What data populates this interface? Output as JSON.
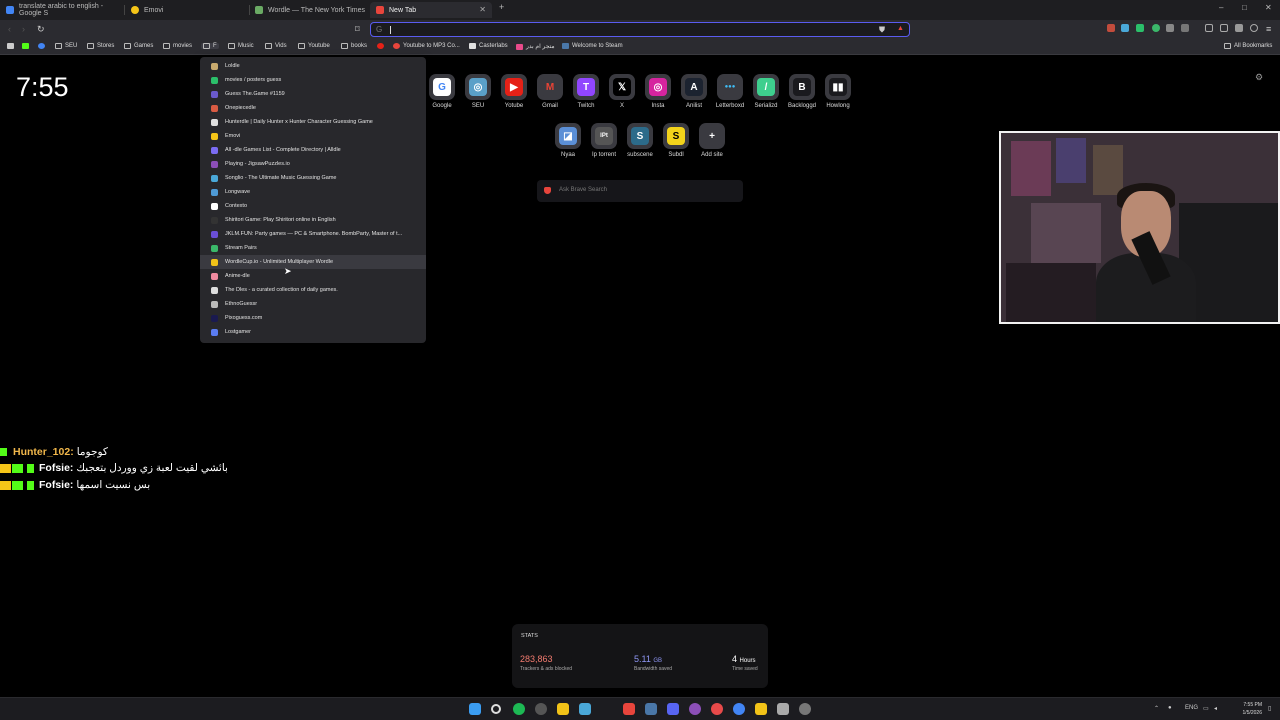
{
  "tabs": [
    {
      "title": "translate arabic to english - Google S",
      "icon_color": "#4285f4",
      "active": false
    },
    {
      "title": "Emovi",
      "icon_color": "#f5c518",
      "active": false
    },
    {
      "title": "Wordle — The New York Times",
      "icon_color": "#6aaa64",
      "active": false
    },
    {
      "title": "New Tab",
      "icon_color": "#e8453c",
      "active": true
    }
  ],
  "new_tab_symbol": "+",
  "window_controls": {
    "minimize": "–",
    "maximize": "□",
    "close": "✕"
  },
  "address_bar": {
    "value": "",
    "search_engine_glyph": "G"
  },
  "bookmarks": [
    {
      "label": "",
      "icon": "apps-icon"
    },
    {
      "label": "",
      "icon": "kick-icon"
    },
    {
      "label": "",
      "icon": "chrome-icon"
    },
    {
      "label": "SEU",
      "icon": "folder-icon"
    },
    {
      "label": "Stores",
      "icon": "folder-icon"
    },
    {
      "label": "Games",
      "icon": "folder-icon"
    },
    {
      "label": "movies",
      "icon": "folder-icon"
    },
    {
      "label": "F",
      "icon": "folder-icon"
    },
    {
      "label": "Music",
      "icon": "folder-icon"
    },
    {
      "label": "Vids",
      "icon": "folder-icon"
    },
    {
      "label": "Youtube",
      "icon": "folder-icon"
    },
    {
      "label": "books",
      "icon": "folder-icon"
    },
    {
      "label": "",
      "icon": "youtube-icon"
    },
    {
      "label": "Youtube to MP3 Co...",
      "icon": "mp3-icon"
    },
    {
      "label": "Casterlabs",
      "icon": "casterlabs-icon"
    },
    {
      "label": "متجر ام بدر",
      "icon": "store-icon"
    },
    {
      "label": "Welcome to Steam",
      "icon": "steam-icon"
    }
  ],
  "all_bookmarks_label": "All Bookmarks",
  "clock": "7:55",
  "top_sites_row1": [
    {
      "label": "Google",
      "glyph": "G",
      "color": "#ffffff",
      "text_color": "#4285f4"
    },
    {
      "label": "SEU",
      "glyph": "◎",
      "color": "#5aa0c8",
      "text_color": "#ffffff"
    },
    {
      "label": "Yotube",
      "glyph": "▶",
      "color": "#e62117",
      "text_color": "#ffffff"
    },
    {
      "label": "Gmail",
      "glyph": "M",
      "color": "#3a3a40",
      "text_color": "#ea4335"
    },
    {
      "label": "Twitch",
      "glyph": "T",
      "color": "#9146ff",
      "text_color": "#ffffff"
    },
    {
      "label": "X",
      "glyph": "𝕏",
      "color": "#000000",
      "text_color": "#ffffff"
    },
    {
      "label": "Insta",
      "glyph": "◎",
      "color": "#d6249f",
      "text_color": "#ffffff"
    },
    {
      "label": "Anilist",
      "glyph": "A",
      "color": "#1c2330",
      "text_color": "#ffffff"
    },
    {
      "label": "Letterboxd",
      "glyph": "●●●",
      "color": "#3a3a40",
      "text_color": "#40bcf4"
    },
    {
      "label": "Serializd",
      "glyph": "/",
      "color": "#3ecf8e",
      "text_color": "#ffffff"
    },
    {
      "label": "Backloggd",
      "glyph": "B",
      "color": "#1a1a1e",
      "text_color": "#ffffff"
    },
    {
      "label": "Howlong",
      "glyph": "▮▮",
      "color": "#1a1a1e",
      "text_color": "#ffffff"
    }
  ],
  "top_sites_row2": [
    {
      "label": "Nyaa",
      "glyph": "◪",
      "color": "#5b8fd6",
      "text_color": "#ffffff"
    },
    {
      "label": "Ip torrent",
      "glyph": "IPt",
      "color": "#555555",
      "text_color": "#ffffff"
    },
    {
      "label": "subscene",
      "glyph": "S",
      "color": "#2c6b8a",
      "text_color": "#ffffff"
    },
    {
      "label": "Subdl",
      "glyph": "S",
      "color": "#f2d31b",
      "text_color": "#000000"
    },
    {
      "label": "Add site",
      "glyph": "+",
      "color": "#3a3a40",
      "text_color": "#ffffff"
    }
  ],
  "ask_placeholder": "Ask Brave Search",
  "dropdown_items": [
    {
      "label": "Loldle",
      "icon_color": "#c8aa6e"
    },
    {
      "label": "movies / posters guess",
      "icon_color": "#2bbf6a"
    },
    {
      "label": "Guess The.Game #1159",
      "icon_color": "#6a5acd"
    },
    {
      "label": "Onepiecedle",
      "icon_color": "#d95b43"
    },
    {
      "label": "Hunterdle | Daily Hunter x Hunter Character Guessing Game",
      "icon_color": "#e0e0e0"
    },
    {
      "label": "Emovi",
      "icon_color": "#f5c518"
    },
    {
      "label": "All -dle Games List - Complete Directory | Alldle",
      "icon_color": "#7b6cf2"
    },
    {
      "label": "Playing - JigsawPuzzles.io",
      "icon_color": "#8c4fb8"
    },
    {
      "label": "Songlio - The Ultimate Music Guessing Game",
      "icon_color": "#4aa8d8"
    },
    {
      "label": "Longwave",
      "icon_color": "#4e9ad6"
    },
    {
      "label": "Contexto",
      "icon_color": "#ffffff"
    },
    {
      "label": "Shiritori Game: Play Shiritori online in English",
      "icon_color": "#333333"
    },
    {
      "label": "JKLM.FUN: Party games — PC & Smartphone. BombParty, Master of t...",
      "icon_color": "#6a4fd6"
    },
    {
      "label": "Stream Pairs",
      "icon_color": "#3bb86a"
    },
    {
      "label": "WordleCup.io - Unlimited Multiplayer Wordle",
      "icon_color": "#f2c318"
    },
    {
      "label": "Anime-dle",
      "icon_color": "#f08aa0"
    },
    {
      "label": "The Dles - a curated collection of daily games.",
      "icon_color": "#dddddd"
    },
    {
      "label": "EthnoGuessr",
      "icon_color": "#bbbbbb"
    },
    {
      "label": "Pixoguess.com",
      "icon_color": "#1a1a50"
    },
    {
      "label": "Lostgamer",
      "icon_color": "#5b7df2"
    }
  ],
  "chat_messages": [
    {
      "name": "Hunter_102:",
      "message": "كوجوما",
      "name_color": "#f2b84b",
      "badges": [
        "kick-badge"
      ]
    },
    {
      "name": "Fofsie:",
      "message": "بائشي لقيت لعبة زي ووردل بتعجبك",
      "name_color": "#ffffff",
      "badges": [
        "crown-badge",
        "gift-badge",
        "kick-badge"
      ]
    },
    {
      "name": "Fofsie:",
      "message": "بس نسيت اسمها",
      "name_color": "#ffffff",
      "badges": [
        "crown-badge",
        "gift-badge",
        "kick-badge"
      ]
    }
  ],
  "stats": {
    "title": "STATS",
    "trackers_value": "283,863",
    "trackers_label": "Trackers & ads blocked",
    "bandwidth_value": "5.11",
    "bandwidth_unit": "GB",
    "bandwidth_label": "Bandwidth saved",
    "time_value": "4",
    "time_unit": "Hours",
    "time_label": "Time saved",
    "colors": {
      "trackers": "#f27b6f",
      "bandwidth": "#8f97f5",
      "time": "#ffffff"
    }
  },
  "taskbar": {
    "lang": "ENG",
    "time": "7:55 PM",
    "date": "1/5/2026"
  }
}
